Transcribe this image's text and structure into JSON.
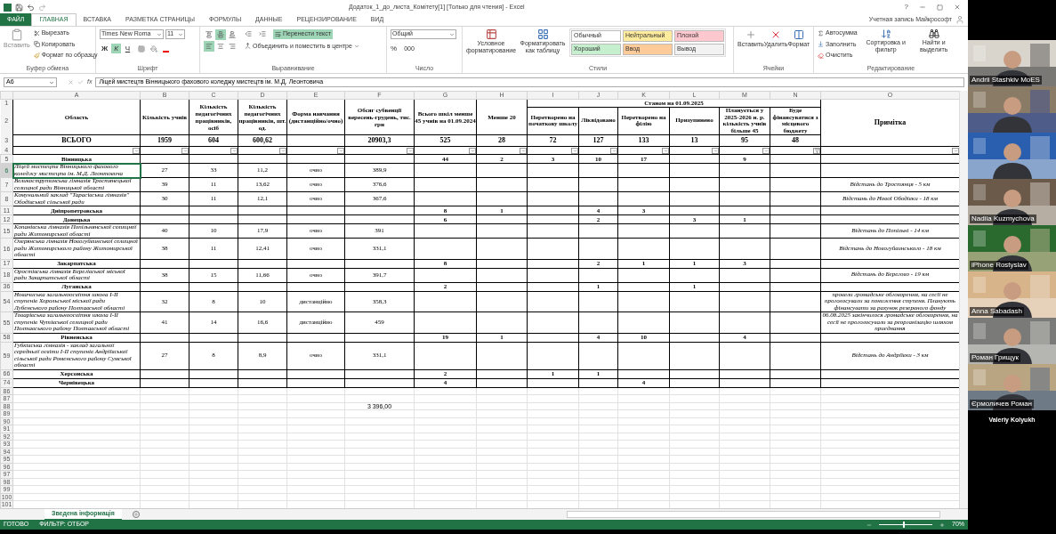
{
  "title_bar": {
    "title": "Додаток_1_до_листа_Комітету[1]  [Только для чтения] - Excel",
    "help": "?"
  },
  "file_tab": "ФАЙЛ",
  "ribbon_tabs": [
    {
      "label": "ГЛАВНАЯ",
      "selected": true
    },
    {
      "label": "ВСТАВКА",
      "selected": false
    },
    {
      "label": "РАЗМЕТКА СТРАНИЦЫ",
      "selected": false
    },
    {
      "label": "ФОРМУЛЫ",
      "selected": false
    },
    {
      "label": "ДАННЫЕ",
      "selected": false
    },
    {
      "label": "РЕЦЕНЗИРОВАНИЕ",
      "selected": false
    },
    {
      "label": "ВИД",
      "selected": false
    }
  ],
  "account": "Учетная запись Майкрософт",
  "clipboard": {
    "paste": "Вставить",
    "cut": "Вырезать",
    "copy": "Копировать",
    "format_painter": "Формат по образцу",
    "label": "Буфер обмена"
  },
  "font": {
    "name": "Times New Roma",
    "size": "11",
    "buttons": [
      {
        "label": "Ж",
        "kind": "bold",
        "on": false
      },
      {
        "label": "К",
        "kind": "italic",
        "on": true
      },
      {
        "label": "Ч",
        "kind": "underline",
        "on": false
      }
    ],
    "label": "Шрифт"
  },
  "alignment": {
    "buttons": [
      {
        "kind": "top",
        "on": false
      },
      {
        "kind": "middle",
        "on": true
      },
      {
        "kind": "bottom",
        "on": false
      },
      {
        "kind": "left",
        "on": true
      },
      {
        "kind": "center",
        "on": false
      },
      {
        "kind": "right",
        "on": false
      }
    ],
    "wrap_text": {
      "label": "Перенести текст",
      "on": true
    },
    "merge": "Объединить и поместить в центре",
    "label": "Выравнивание"
  },
  "number": {
    "format": "Общий",
    "percent": "%",
    "thousands": "000",
    "label": "Число"
  },
  "styles": {
    "conditional": "Условное форматирование",
    "as_table": "Форматировать как таблицу",
    "label": "Стили",
    "cells": [
      {
        "label": "Обычный",
        "color": "#ffffff"
      },
      {
        "label": "Нейтральный",
        "color": "#ffeb9c"
      },
      {
        "label": "Плохой",
        "color": "#ffc7ce"
      },
      {
        "label": "Хороший",
        "color": "#c6efce"
      },
      {
        "label": "Ввод",
        "color": "#ffcc99"
      },
      {
        "label": "Вывод",
        "color": "#f2f2f2"
      }
    ]
  },
  "cells_group": {
    "insert": "Вставить",
    "delete": "Удалить",
    "format": "Формат",
    "label": "Ячейки"
  },
  "editing": {
    "autosum": "Автосумма",
    "fill": "Заполнить",
    "clear": "Очистить",
    "sort": "Сортировка и фильтр",
    "find": "Найти и выделить",
    "label": "Редактирование"
  },
  "formula_bar": {
    "name_box": "A6",
    "fx": "fx",
    "formula": "Ліцей мистецтв Вінницького фахового коледжу мистецтв ім. М.Д. Леонтовича"
  },
  "sheet": {
    "columns": [
      "A",
      "B",
      "C",
      "D",
      "E",
      "F",
      "G",
      "H",
      "I",
      "J",
      "K",
      "L",
      "M",
      "N",
      "O"
    ],
    "header_row_numbers": [
      "1",
      "2",
      "3",
      "4"
    ],
    "headers": [
      "Область",
      "Кількість учнів",
      "Кількість педагогічних працівників, осіб",
      "Кількість педагогічних працівників, шт. од.",
      "Форма навчання (дистанційно/очно)",
      "Обсяг субвенції вересень-грудень, тис. грн",
      "Всього шкіл менше 45 учнів на 01.09.2024",
      "Менше 20",
      "Перетворено на початкову школу",
      "Ліквідовано",
      "Перетворено на філію",
      "Призупинено",
      "Планується у 2025-2026 н. р. кількість учнів більше 45",
      "Буде фінансуватися з місцевого бюджету",
      "Примітка"
    ],
    "group_header": "Станом на 01.09.2025",
    "totals": {
      "A": "ВСЬОГО",
      "B": "1959",
      "C": "604",
      "D": "600,62",
      "F": "20903,3",
      "G": "525",
      "H": "28",
      "I": "72",
      "J": "127",
      "K": "133",
      "L": "13",
      "M": "95",
      "N": "48"
    },
    "filters": [
      {
        "active": false
      },
      {
        "active": false
      },
      {
        "active": false
      },
      {
        "active": false
      },
      {
        "active": false
      },
      {
        "active": false
      },
      {
        "active": false
      },
      {
        "active": false
      },
      {
        "active": false
      },
      {
        "active": false
      },
      {
        "active": false
      },
      {
        "active": false
      },
      {
        "active": false
      },
      {
        "active": true
      },
      {
        "active": false
      }
    ],
    "rows": [
      {
        "num": "5",
        "kind": "region",
        "selected": false,
        "cells": {
          "A": "Вінницька",
          "G": "44",
          "H": "2",
          "I": "3",
          "J": "10",
          "K": "17",
          "M": "9"
        }
      },
      {
        "num": "6",
        "kind": "school",
        "selected": true,
        "cells": {
          "A": "Ліцей мистецтв Вінницького фахового коледжу мистецтв ім. М.Д. Леонтовича",
          "B": "27",
          "C": "33",
          "D": "11,2",
          "E": "очно",
          "F": "389,9"
        }
      },
      {
        "num": "7",
        "kind": "school",
        "selected": false,
        "cells": {
          "A": "Великострутинська гімназія Тростянецької селищної ради Вінницької області",
          "B": "39",
          "C": "11",
          "D": "13,62",
          "E": "очно",
          "F": "376,6",
          "O": "Відстань до Тростянця - 5 км"
        }
      },
      {
        "num": "8",
        "kind": "school",
        "selected": false,
        "cells": {
          "A": "Комунальний заклад \"Тарасівська гімназія\" Ободівської сільської ради",
          "B": "30",
          "C": "11",
          "D": "12,1",
          "E": "очно",
          "F": "367,6",
          "O": "Відстань до Нової Ободівки - 18 км"
        }
      },
      {
        "num": "11",
        "kind": "region",
        "selected": false,
        "cells": {
          "A": "Дніпропетровська",
          "G": "8",
          "H": "1",
          "J": "4",
          "K": "3"
        }
      },
      {
        "num": "12",
        "kind": "region",
        "selected": false,
        "cells": {
          "A": "Донецька",
          "G": "6",
          "J": "2",
          "L": "3",
          "M": "1"
        }
      },
      {
        "num": "15",
        "kind": "school",
        "selected": false,
        "cells": {
          "A": "Копанівська гімназія Попільнянської селищної ради Житомирської області",
          "B": "40",
          "C": "10",
          "D": "17,9",
          "E": "очно",
          "F": "391",
          "O": "Відстань до Попільні - 14 км"
        }
      },
      {
        "num": "16",
        "kind": "school",
        "selected": false,
        "cells": {
          "A": "Озерянська гімназія Новогуйвинської селищної ради Житомирського району Житомирської області",
          "B": "38",
          "C": "11",
          "D": "12,41",
          "E": "очно",
          "F": "331,1",
          "O": "Відстань до Новогуйвинського - 18 км"
        }
      },
      {
        "num": "17",
        "kind": "region",
        "selected": false,
        "cells": {
          "A": "Закарпатська",
          "G": "8",
          "J": "2",
          "K": "1",
          "L": "1",
          "M": "3"
        }
      },
      {
        "num": "18",
        "kind": "school",
        "selected": false,
        "cells": {
          "A": "Оростівська гімназія Берегівської міської ради Закарпатської області",
          "B": "38",
          "C": "15",
          "D": "11,66",
          "E": "очно",
          "F": "391,7",
          "O": "Відстань до Берегово - 19 км"
        }
      },
      {
        "num": "36",
        "kind": "region",
        "selected": false,
        "cells": {
          "A": "Луганська",
          "G": "2",
          "J": "1",
          "L": "1"
        }
      },
      {
        "num": "54",
        "kind": "school",
        "selected": false,
        "cells": {
          "A": "Новачиська загальноосвітня школа І-ІІ ступенів Хорольської міської ради Лубенського району Полтавської області",
          "B": "32",
          "C": "8",
          "D": "10",
          "E": "дистанційно",
          "F": "358,3",
          "O": "провели громадське обговорення, на сесії не проголосували за пониження ступеня. Планують фінансувати за рахунок резервного фонду"
        }
      },
      {
        "num": "55",
        "kind": "school",
        "selected": false,
        "cells": {
          "A": "Товарівська загальноосвітня школа І-ІІ ступенів Чутівської селищної ради Полтавського району Полтавської області",
          "B": "41",
          "C": "14",
          "D": "16,6",
          "E": "дистанційно",
          "F": "459",
          "O": "06.08.2025 закінчилося громадське обговорення, на сесії не проголосували за реорганізацію шляхом приєднання"
        }
      },
      {
        "num": "58",
        "kind": "region",
        "selected": false,
        "cells": {
          "A": "Рівненська",
          "G": "19",
          "H": "1",
          "J": "4",
          "K": "10",
          "M": "4"
        }
      },
      {
        "num": "59",
        "kind": "school",
        "selected": false,
        "cells": {
          "A": "Губківська гімназія - заклад загальної середньої освіти І-ІІ ступенів Андріївської сільської ради Роменського району Сумської області",
          "B": "27",
          "C": "8",
          "D": "8,9",
          "E": "очно",
          "F": "331,1",
          "O": "Відстань до Андріївки - 3 км"
        }
      },
      {
        "num": "66",
        "kind": "region",
        "selected": false,
        "cells": {
          "A": "Херсонська",
          "G": "2",
          "I": "1",
          "J": "1"
        }
      },
      {
        "num": "74",
        "kind": "region",
        "selected": false,
        "cells": {
          "A": "Чернівецька",
          "G": "4",
          "K": "4"
        }
      },
      {
        "num": "86",
        "kind": "plain",
        "selected": false,
        "cells": {}
      },
      {
        "num": "87",
        "kind": "plain",
        "selected": false,
        "cells": {}
      },
      {
        "num": "88",
        "kind": "plain",
        "selected": false,
        "cells": {
          "F": "3 396,00"
        }
      },
      {
        "num": "89",
        "kind": "plain",
        "selected": false,
        "cells": {}
      },
      {
        "num": "90",
        "kind": "plain",
        "selected": false,
        "cells": {}
      },
      {
        "num": "91",
        "kind": "plain",
        "selected": false,
        "cells": {}
      },
      {
        "num": "92",
        "kind": "plain",
        "selected": false,
        "cells": {}
      },
      {
        "num": "93",
        "kind": "plain",
        "selected": false,
        "cells": {}
      },
      {
        "num": "94",
        "kind": "plain",
        "selected": false,
        "cells": {}
      },
      {
        "num": "95",
        "kind": "plain",
        "selected": false,
        "cells": {}
      },
      {
        "num": "96",
        "kind": "plain",
        "selected": false,
        "cells": {}
      },
      {
        "num": "97",
        "kind": "plain",
        "selected": false,
        "cells": {}
      },
      {
        "num": "98",
        "kind": "plain",
        "selected": false,
        "cells": {}
      },
      {
        "num": "99",
        "kind": "plain",
        "selected": false,
        "cells": {}
      },
      {
        "num": "100",
        "kind": "plain",
        "selected": false,
        "cells": {}
      },
      {
        "num": "101",
        "kind": "plain",
        "selected": false,
        "cells": {}
      }
    ]
  },
  "sheet_tabs": [
    {
      "label": "Зведена інформація",
      "selected": true
    }
  ],
  "status_bar": {
    "ready": "ГОТОВО",
    "filter": "ФИЛЬТР: ОТБОР",
    "zoom": "70%"
  },
  "participants": [
    {
      "name": "Andrii Stashkiv MoES",
      "video": true
    },
    {
      "video": true
    },
    {
      "video": true
    },
    {
      "name": "Nadiia Kuzmychova",
      "video": true
    },
    {
      "name": "iPhone Rostyslav",
      "video": true
    },
    {
      "name": "Anna Sabadash",
      "video": true
    },
    {
      "name": "Роман Грищук",
      "video": true
    },
    {
      "name": "Єрмоличев Роман",
      "video": true
    },
    {
      "name": "Valeriy Kolyukh",
      "video": false
    }
  ]
}
